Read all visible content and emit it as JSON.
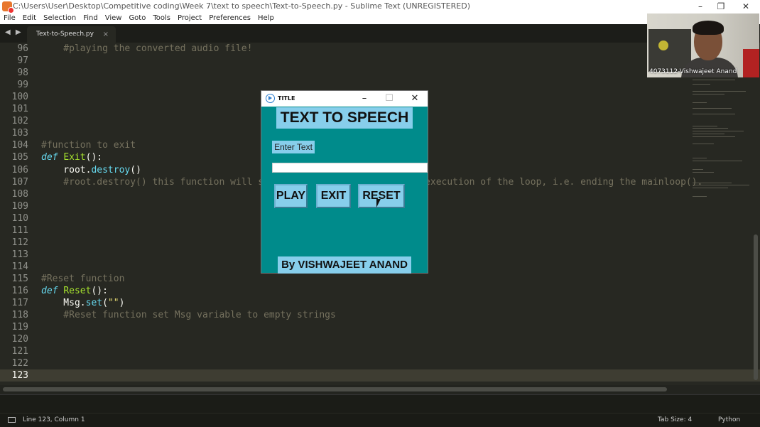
{
  "window": {
    "title": "C:\\Users\\User\\Desktop\\Competitive coding\\Week 7\\text to speech\\Text-to-Speech.py - Sublime Text (UNREGISTERED)",
    "minimize": "–",
    "maximize": "❐",
    "close": "✕"
  },
  "menu": [
    "File",
    "Edit",
    "Selection",
    "Find",
    "View",
    "Goto",
    "Tools",
    "Project",
    "Preferences",
    "Help"
  ],
  "tab": {
    "label": "Text-to-Speech.py",
    "close": "×"
  },
  "navigation": {
    "arrows": "◀ ▶"
  },
  "editor": {
    "lines": [
      {
        "n": "96",
        "tokens": [
          {
            "c": "cm",
            "t": "    #playing the converted audio file!"
          }
        ]
      },
      {
        "n": "97",
        "tokens": []
      },
      {
        "n": "98",
        "tokens": []
      },
      {
        "n": "99",
        "tokens": []
      },
      {
        "n": "100",
        "tokens": []
      },
      {
        "n": "101",
        "tokens": []
      },
      {
        "n": "102",
        "tokens": []
      },
      {
        "n": "103",
        "tokens": []
      },
      {
        "n": "104",
        "tokens": [
          {
            "c": "cm",
            "t": "#function to exit"
          }
        ]
      },
      {
        "n": "105",
        "tokens": [
          {
            "c": "kw",
            "t": "def"
          },
          {
            "c": "",
            "t": " "
          },
          {
            "c": "fn",
            "t": "Exit"
          },
          {
            "c": "",
            "t": "():"
          }
        ]
      },
      {
        "n": "106",
        "tokens": [
          {
            "c": "",
            "t": "    root."
          },
          {
            "c": "bi",
            "t": "destroy"
          },
          {
            "c": "",
            "t": "()"
          }
        ]
      },
      {
        "n": "107",
        "tokens": [
          {
            "c": "cm",
            "t": "    #root.destroy() this function will stop the program and stop the execution of the loop, i.e. ending the mainloop()."
          }
        ]
      },
      {
        "n": "108",
        "tokens": []
      },
      {
        "n": "109",
        "tokens": []
      },
      {
        "n": "110",
        "tokens": []
      },
      {
        "n": "111",
        "tokens": []
      },
      {
        "n": "112",
        "tokens": []
      },
      {
        "n": "113",
        "tokens": []
      },
      {
        "n": "114",
        "tokens": []
      },
      {
        "n": "115",
        "tokens": [
          {
            "c": "cm",
            "t": "#Reset function"
          }
        ]
      },
      {
        "n": "116",
        "tokens": [
          {
            "c": "kw",
            "t": "def"
          },
          {
            "c": "",
            "t": " "
          },
          {
            "c": "fn",
            "t": "Reset"
          },
          {
            "c": "",
            "t": "():"
          }
        ]
      },
      {
        "n": "117",
        "tokens": [
          {
            "c": "",
            "t": "    Msg."
          },
          {
            "c": "bi",
            "t": "set"
          },
          {
            "c": "",
            "t": "("
          },
          {
            "c": "st",
            "t": "\"\""
          },
          {
            "c": "",
            "t": ")"
          }
        ]
      },
      {
        "n": "118",
        "tokens": [
          {
            "c": "cm",
            "t": "    #Reset function set Msg variable to empty strings"
          }
        ]
      },
      {
        "n": "119",
        "tokens": []
      },
      {
        "n": "120",
        "tokens": []
      },
      {
        "n": "121",
        "tokens": []
      },
      {
        "n": "122",
        "tokens": []
      },
      {
        "n": "123",
        "tokens": [],
        "current": true
      }
    ]
  },
  "webcam": {
    "label": "4073112-Vishwajeet Anand"
  },
  "tkapp": {
    "title": "TITLE",
    "minimize": "–",
    "maximize": "☐",
    "close": "✕",
    "heading": "TEXT TO SPEECH",
    "entry_label": "Enter Text",
    "entry_value": "",
    "buttons": {
      "play": "PLAY",
      "exit": "EXIT",
      "reset": "RESET"
    },
    "footer": "By VISHWAJEET ANAND"
  },
  "status": {
    "position": "Line 123, Column 1",
    "tab_size": "Tab Size: 4",
    "syntax": "Python"
  },
  "colors": {
    "editor_bg": "#272822",
    "tk_bg": "#008b8b",
    "tk_widget": "#87ceeb"
  }
}
